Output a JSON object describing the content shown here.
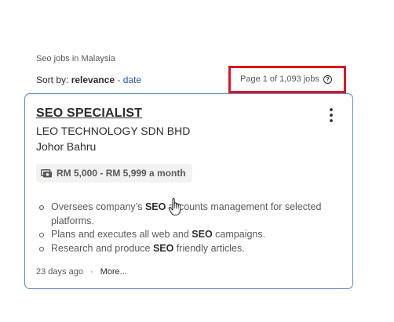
{
  "results_header": {
    "context_title": "Seo jobs in Malaysia",
    "sort_prefix": "Sort by:",
    "sort_active": "relevance",
    "sort_separator": "-",
    "sort_alternative": "date",
    "page_count_text": "Page 1 of 1,093 jobs",
    "help_icon_glyph": "?"
  },
  "job_card": {
    "title": "SEO SPECIALIST",
    "company": "LEO TECHNOLOGY SDN BHD",
    "location": "Johor Bahru",
    "salary": "RM 5,000 - RM 5,999 a month",
    "salary_icon": "money-icon",
    "menu_icon": "kebab-menu-icon",
    "snippet": [
      {
        "before": "Oversees company’s ",
        "bold": "SEO",
        "after": " accounts management for selected platforms."
      },
      {
        "before": "Plans and executes all web and ",
        "bold": "SEO",
        "after": " campaigns."
      },
      {
        "before": "Research and produce ",
        "bold": "SEO",
        "after": " friendly articles."
      }
    ],
    "posted": "23 days ago",
    "footer_separator": "·",
    "more_link": "More..."
  },
  "colors": {
    "highlight_border": "#e0141e",
    "card_border": "#5e87cf",
    "link_blue": "#2557a7",
    "chip_background": "#f3f2f1"
  },
  "cursor_icon": "hand-pointer-icon"
}
